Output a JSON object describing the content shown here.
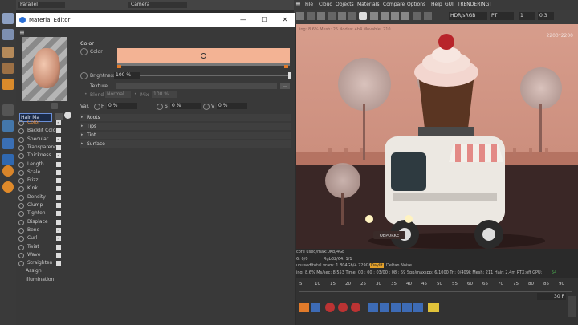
{
  "viewport": {
    "camera_mode": "Parallel",
    "camera_name": "Camera",
    "resolution": "2200*2200"
  },
  "menu": {
    "items": [
      "File",
      "Cloud",
      "Objects",
      "Materials",
      "Compare",
      "Options",
      "Help",
      "GUI",
      "[RENDERING]"
    ],
    "color_space": "HDR/sRGB",
    "render_mode": "PT",
    "frame_value": "1",
    "exposure": "0.3"
  },
  "material_editor": {
    "title": "Material Editor",
    "window_buttons": {
      "minimize": "—",
      "maximize": "☐",
      "close": "✕"
    },
    "material_name": "Hair Ma",
    "channels": [
      {
        "label": "Color",
        "checked": true,
        "active": true
      },
      {
        "label": "Backlit Color",
        "checked": false
      },
      {
        "label": "Specular",
        "checked": true
      },
      {
        "label": "Transparency",
        "checked": false
      },
      {
        "label": "Thickness",
        "checked": true
      },
      {
        "label": "Length",
        "checked": false
      },
      {
        "label": "Scale",
        "checked": false
      },
      {
        "label": "Frizz",
        "checked": false
      },
      {
        "label": "Kink",
        "checked": false
      },
      {
        "label": "Density",
        "checked": false
      },
      {
        "label": "Clump",
        "checked": false
      },
      {
        "label": "Tighten",
        "checked": false
      },
      {
        "label": "Displace",
        "checked": false
      },
      {
        "label": "Bend",
        "checked": true
      },
      {
        "label": "Curl",
        "checked": true
      },
      {
        "label": "Twist",
        "checked": false
      },
      {
        "label": "Wave",
        "checked": false
      },
      {
        "label": "Straighten",
        "checked": false
      }
    ],
    "extra_items": [
      "Assign",
      "Illumination"
    ],
    "panel": {
      "section_title": "Color",
      "color_label": "Color",
      "color_swatch": "#f3b394",
      "brightness_label": "Brightness",
      "brightness_value": "100 %",
      "texture_label": "Texture",
      "blend_label": "Blend",
      "blend_value": "Normal",
      "mix_label": "Mix",
      "mix_value": "100 %",
      "var_label": "Var.",
      "h_label": "H",
      "h_value": "0 %",
      "s_label": "S",
      "s_value": "0 %",
      "v_label": "V",
      "v_value": "0 %",
      "groups": [
        "Roots",
        "Tips",
        "Tint",
        "Surface"
      ]
    }
  },
  "stats": {
    "line1": "core used/max:0Kb/4Gb",
    "line2a": "6: 0/0",
    "line2b": "Rgb32/64: 1/1",
    "line3": "unused/total vram: 1.804Gb/4.729Gb/8Gb",
    "denoise": "Daylit",
    "denoise2": "Deltan Noise",
    "render_line": "ing: 8.6%   Ms/sec: 8.553   Time: 00 : 00 : 03/00 : 08 : 59   Spp/maxspp: 6/1000   Tri: 0/409k   Mesh: 211   Hair: 2.4m   RTX:off   GPU:",
    "gpu_value": "54",
    "top_status": "ing: 8.6%  Mesh: 25  Nodes: 4b4  Movable: 210"
  },
  "timeline": {
    "ticks": [
      "5",
      "10",
      "15",
      "20",
      "25",
      "30",
      "35",
      "40",
      "45",
      "50",
      "55",
      "60",
      "65",
      "70",
      "75",
      "80",
      "85",
      "90"
    ],
    "frame_display": "30 F"
  },
  "scene": {
    "truck_plate": "OBPORKE"
  },
  "colors": {
    "accent": "#2a6fd6",
    "swatch": "#f3b394",
    "gpu_green": "#4caf50"
  }
}
